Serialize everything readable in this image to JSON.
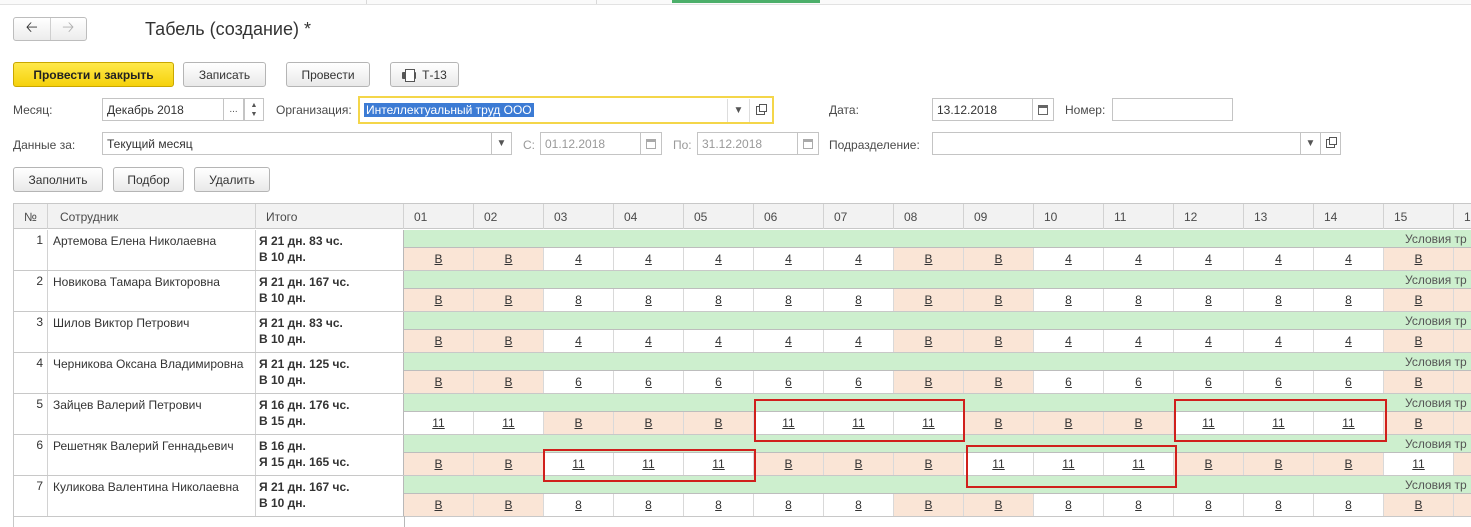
{
  "window": {
    "title": "Табель (создание) *"
  },
  "nav": {
    "back_icon": "arrow-left-icon",
    "forward_icon": "arrow-right-icon"
  },
  "toolbar": {
    "post_close": "Провести и закрыть",
    "save": "Записать",
    "post": "Провести",
    "print": "Т-13"
  },
  "form": {
    "month_label": "Месяц:",
    "month_value": "Декабрь 2018",
    "org_label": "Организация:",
    "org_value": "Интеллектуальный труд ООО",
    "date_label": "Дата:",
    "date_value": "13.12.2018",
    "number_label": "Номер:",
    "number_value": "",
    "period_label": "Данные за:",
    "period_value": "Текущий месяц",
    "from_label": "С:",
    "from_value": "01.12.2018",
    "to_label": "По:",
    "to_value": "31.12.2018",
    "dept_label": "Подразделение:",
    "dept_value": ""
  },
  "actions": {
    "fill": "Заполнить",
    "select": "Подбор",
    "delete": "Удалить"
  },
  "table": {
    "columns": {
      "num": "№",
      "employee": "Сотрудник",
      "total": "Итого"
    },
    "days": [
      "01",
      "02",
      "03",
      "04",
      "05",
      "06",
      "07",
      "08",
      "09",
      "10",
      "11",
      "12",
      "13",
      "14",
      "15",
      "1"
    ],
    "condition_text": "Условия тр",
    "rows": [
      {
        "num": "1",
        "name": "Артемова Елена Николаевна",
        "total1": "Я 21 дн. 83 чс.",
        "total2": "В 10 дн.",
        "days": [
          "В",
          "В",
          "4",
          "4",
          "4",
          "4",
          "4",
          "В",
          "В",
          "4",
          "4",
          "4",
          "4",
          "4",
          "В"
        ]
      },
      {
        "num": "2",
        "name": "Новикова Тамара Викторовна",
        "total1": "Я 21 дн. 167 чс.",
        "total2": "В 10 дн.",
        "days": [
          "В",
          "В",
          "8",
          "8",
          "8",
          "8",
          "8",
          "В",
          "В",
          "8",
          "8",
          "8",
          "8",
          "8",
          "В"
        ]
      },
      {
        "num": "3",
        "name": "Шилов Виктор Петрович",
        "total1": "Я 21 дн. 83 чс.",
        "total2": "В 10 дн.",
        "days": [
          "В",
          "В",
          "4",
          "4",
          "4",
          "4",
          "4",
          "В",
          "В",
          "4",
          "4",
          "4",
          "4",
          "4",
          "В"
        ]
      },
      {
        "num": "4",
        "name": "Черникова Оксана Владимировна",
        "total1": "Я 21 дн. 125 чс.",
        "total2": "В 10 дн.",
        "days": [
          "В",
          "В",
          "6",
          "6",
          "6",
          "6",
          "6",
          "В",
          "В",
          "6",
          "6",
          "6",
          "6",
          "6",
          "В"
        ]
      },
      {
        "num": "5",
        "name": "Зайцев Валерий Петрович",
        "total1": "Я 16 дн. 176 чс.",
        "total2": "В 15 дн.",
        "days": [
          "11",
          "11",
          "В",
          "В",
          "В",
          "11",
          "11",
          "11",
          "В",
          "В",
          "В",
          "11",
          "11",
          "11",
          "В"
        ]
      },
      {
        "num": "6",
        "name": "Решетняк Валерий Геннадьевич",
        "total1": "В 16 дн.",
        "total2": "Я 15 дн. 165 чс.",
        "days": [
          "В",
          "В",
          "11",
          "11",
          "11",
          "В",
          "В",
          "В",
          "11",
          "11",
          "11",
          "В",
          "В",
          "В",
          "11"
        ]
      },
      {
        "num": "7",
        "name": "Куликова Валентина Николаевна",
        "total1": "Я 21 дн. 167 чс.",
        "total2": "В 10 дн.",
        "days": [
          "В",
          "В",
          "8",
          "8",
          "8",
          "8",
          "8",
          "В",
          "В",
          "8",
          "8",
          "8",
          "8",
          "8",
          "В"
        ]
      }
    ]
  }
}
